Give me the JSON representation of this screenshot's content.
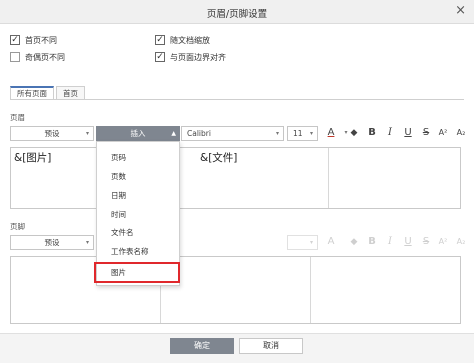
{
  "dialog": {
    "title": "页眉/页脚设置",
    "close_glyph": "×"
  },
  "options": [
    {
      "label": "首页不同",
      "checked": true,
      "mark": "✓"
    },
    {
      "label": "奇偶页不同",
      "checked": false,
      "mark": ""
    },
    {
      "label": "随文档缩放",
      "checked": true,
      "mark": "✓"
    },
    {
      "label": "与页面边界对齐",
      "checked": true,
      "mark": "✓"
    }
  ],
  "tabs": [
    {
      "label": "所有页面",
      "active": true
    },
    {
      "label": "首页",
      "active": false
    }
  ],
  "header": {
    "label": "页眉",
    "preset_label": "预设",
    "insert_label": "插入",
    "font_name": "Calibri",
    "font_size": "11",
    "left_text": "&[图片]",
    "center_text": "&[文件]",
    "right_text": ""
  },
  "footer_section": {
    "label": "页脚",
    "preset_label": "预设"
  },
  "format_icons": {
    "font_color": "A",
    "fill_color": "◆",
    "bold": "B",
    "italic": "I",
    "underline": "U",
    "strike": "S",
    "superscript": "A²",
    "subscript": "A₂"
  },
  "insert_menu": {
    "items": [
      "页码",
      "页数",
      "日期",
      "时间",
      "文件名",
      "工作表名称",
      "图片"
    ],
    "highlighted": "图片",
    "highlight_color": "#e0282c"
  },
  "buttons": {
    "ok": "确定",
    "cancel": "取消"
  },
  "colors": {
    "accent": "#4a74b4",
    "primary_button": "#7f8690",
    "highlight": "#e0282c"
  },
  "icons": {
    "dropdown": "▾",
    "triangle": "▲",
    "chevron_up": "▴"
  }
}
